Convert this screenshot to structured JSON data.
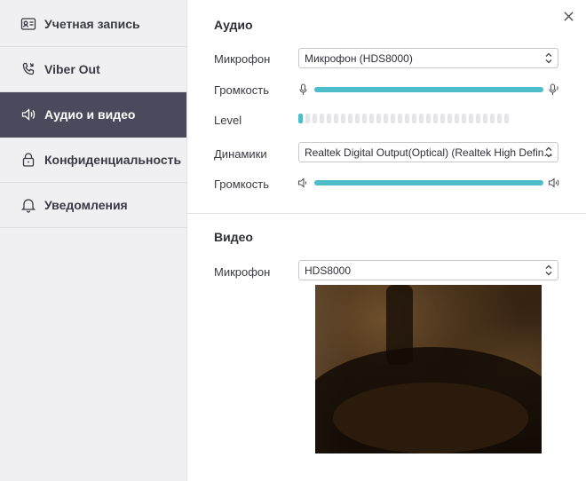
{
  "sidebar": {
    "items": [
      {
        "label": "Учетная запись",
        "icon": "contact-card-icon",
        "active": false
      },
      {
        "label": "Viber Out",
        "icon": "phone-icon",
        "active": false
      },
      {
        "label": "Аудио и видео",
        "icon": "speaker-icon",
        "active": true
      },
      {
        "label": "Конфиденциальность",
        "icon": "lock-icon",
        "active": false
      },
      {
        "label": "Уведомления",
        "icon": "bell-icon",
        "active": false
      }
    ]
  },
  "audio": {
    "title": "Аудио",
    "microphone_label": "Микрофон",
    "microphone_value": "Микрофон (HDS8000)",
    "mic_volume_label": "Громкость",
    "mic_volume_level": 1.0,
    "level_label": "Level",
    "level_active_bars": 1,
    "level_total_bars": 30,
    "speakers_label": "Динамики",
    "speakers_value": "Realtek Digital Output(Optical) (Realtek High Defin...",
    "speaker_volume_label": "Громкость",
    "speaker_volume_level": 1.0
  },
  "video": {
    "title": "Видео",
    "camera_label": "Микрофон",
    "camera_value": "HDS8000"
  },
  "colors": {
    "accent": "#4fbcca",
    "sidebar_active": "#4a4a5c",
    "sidebar_bg": "#f0f0f2"
  },
  "close_icon": "close-icon"
}
